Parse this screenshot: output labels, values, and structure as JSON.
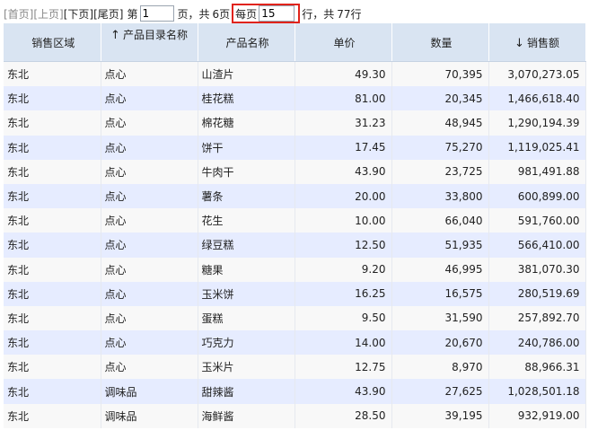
{
  "pager": {
    "first": "[首页]",
    "prev": "[上页]",
    "next": "[下页]",
    "last": "[尾页]",
    "page_prefix": "第",
    "current_page": "1",
    "page_suffix": "页，共",
    "total_pages": "6页",
    "per_page_label": "每页",
    "per_page_value": "15",
    "per_page_suffix": "行，共",
    "total_rows": "77行"
  },
  "table": {
    "columns": [
      {
        "label": "销售区域",
        "sort": ""
      },
      {
        "label": "产品目录名称",
        "sort": "↑"
      },
      {
        "label": "产品名称",
        "sort": ""
      },
      {
        "label": "单价",
        "sort": ""
      },
      {
        "label": "数量",
        "sort": ""
      },
      {
        "label": "销售额",
        "sort": "↓"
      }
    ],
    "rows": [
      [
        "东北",
        "点心",
        "山渣片",
        "49.30",
        "70,395",
        "3,070,273.05"
      ],
      [
        "东北",
        "点心",
        "桂花糕",
        "81.00",
        "20,345",
        "1,466,618.40"
      ],
      [
        "东北",
        "点心",
        "棉花糖",
        "31.23",
        "48,945",
        "1,290,194.39"
      ],
      [
        "东北",
        "点心",
        "饼干",
        "17.45",
        "75,270",
        "1,119,025.41"
      ],
      [
        "东北",
        "点心",
        "牛肉干",
        "43.90",
        "23,725",
        "981,491.88"
      ],
      [
        "东北",
        "点心",
        "薯条",
        "20.00",
        "33,800",
        "600,899.00"
      ],
      [
        "东北",
        "点心",
        "花生",
        "10.00",
        "66,040",
        "591,760.00"
      ],
      [
        "东北",
        "点心",
        "绿豆糕",
        "12.50",
        "51,935",
        "566,410.00"
      ],
      [
        "东北",
        "点心",
        "糖果",
        "9.20",
        "46,995",
        "381,070.30"
      ],
      [
        "东北",
        "点心",
        "玉米饼",
        "16.25",
        "16,575",
        "280,519.69"
      ],
      [
        "东北",
        "点心",
        "蛋糕",
        "9.50",
        "31,590",
        "257,892.70"
      ],
      [
        "东北",
        "点心",
        "巧克力",
        "14.00",
        "20,670",
        "240,786.00"
      ],
      [
        "东北",
        "点心",
        "玉米片",
        "12.75",
        "8,970",
        "88,966.31"
      ],
      [
        "东北",
        "调味品",
        "甜辣酱",
        "43.90",
        "27,625",
        "1,028,501.18"
      ],
      [
        "东北",
        "调味品",
        "海鲜酱",
        "28.50",
        "39,195",
        "932,919.00"
      ]
    ]
  }
}
